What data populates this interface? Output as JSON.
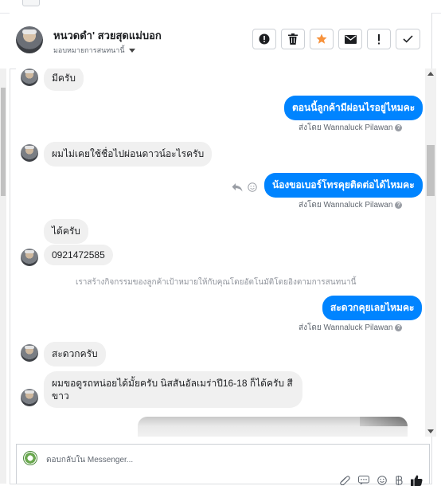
{
  "header": {
    "name": "หนวดดำ' สวยสุดแม่บอก",
    "assign_label": "มอบหมายการสนทนานี้",
    "buttons": [
      {
        "name": "spam-button",
        "icon": "alert-circle-icon"
      },
      {
        "name": "delete-button",
        "icon": "trash-icon"
      },
      {
        "name": "star-button",
        "icon": "star-icon"
      },
      {
        "name": "mark-unread-button",
        "icon": "envelope-icon"
      },
      {
        "name": "follow-up-button",
        "icon": "exclamation-icon"
      },
      {
        "name": "done-button",
        "icon": "check-icon"
      }
    ]
  },
  "messages": {
    "m1": "มีครับ",
    "m2": "ตอนนี้ลูกค้ามีผ่อนไรอยู่ไหมคะ",
    "m2_sent": "ส่งโดย Wannaluck Pilawan",
    "m3": "ผมไม่เคยใช้ชื่อไปผ่อนดาวน์อะไรครับ",
    "m4": "น้องขอเบอร์โทรคุยติดต่อได้ไหมคะ",
    "m4_sent": "ส่งโดย Wannaluck Pilawan",
    "m5": "ได้ครับ",
    "m6": "0921472585",
    "system": "เราสร้างกิจกรรมของลูกค้าเป้าหมายให้กับคุณโดยอัตโนมัติโดยอิงตามการสนทนานี้",
    "m7": "สะดวกคุยเลยไหมคะ",
    "m7_sent": "ส่งโดย Wannaluck Pilawan",
    "m8": "สะดวกครับ",
    "m9_line1": "ผมขอดูรถหน่อยได้มั้ยครับ นิสสันอัลเมร่าปี16-18 ก็ได้ครับ สี",
    "m9_line2": "ขาว"
  },
  "composer": {
    "placeholder": "ตอบกลับใน Messenger..."
  },
  "colors": {
    "outgoing_bubble": "#0084ff",
    "incoming_bubble": "#f0f0f0",
    "star": "#f7923b"
  }
}
